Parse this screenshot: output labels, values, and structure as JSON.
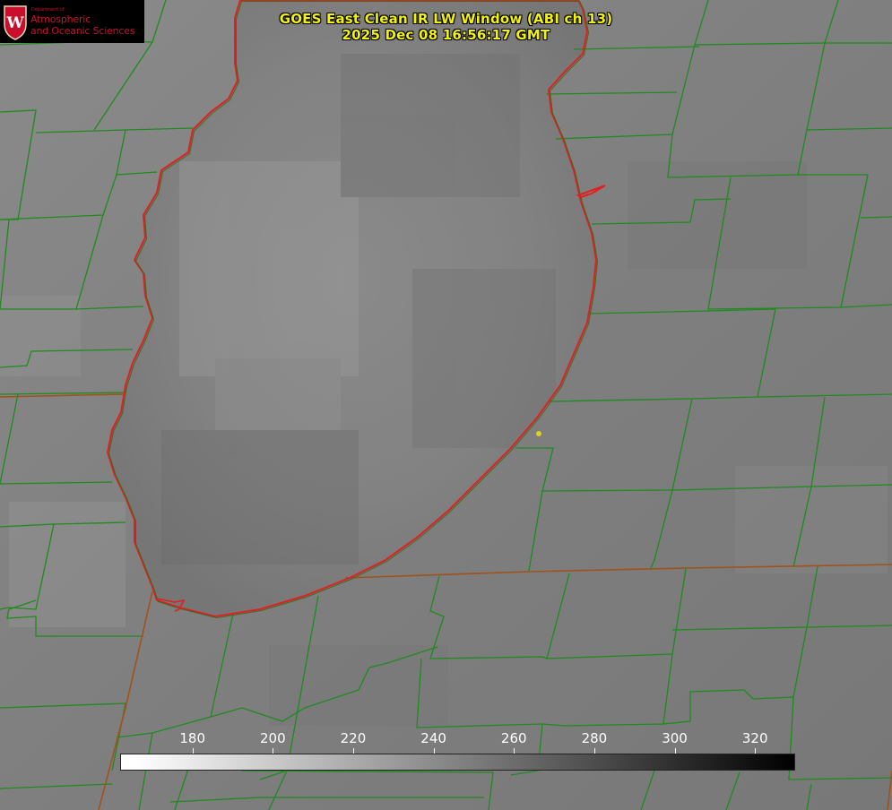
{
  "title": {
    "line1": "GOES East Clean IR LW Window (ABI ch 13)",
    "line2": "2025 Dec 08 16:56:17 GMT"
  },
  "logo": {
    "department": "Department of",
    "line1": "Atmospheric",
    "line2": "and Oceanic Sciences",
    "crest_icon": "uw-crest-icon"
  },
  "colorbar": {
    "ticks": [
      "180",
      "200",
      "220",
      "240",
      "260",
      "280",
      "300",
      "320"
    ],
    "range": [
      162,
      330
    ],
    "colormap": "white-to-black",
    "tick_values": [
      180,
      200,
      220,
      240,
      260,
      280,
      300,
      320
    ]
  },
  "colors": {
    "title_text": "#f2f20a",
    "coastline": "#e02020",
    "county_borders": "#1f8a1f",
    "state_borders": "#a0521a",
    "marker": "#e0d020"
  },
  "marker": {
    "label": "",
    "shape": "yellow-dot"
  }
}
